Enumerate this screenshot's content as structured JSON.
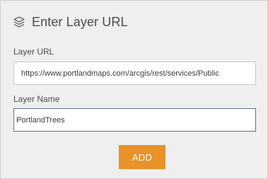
{
  "header": {
    "icon": "layers-icon",
    "title": "Enter Layer URL"
  },
  "form": {
    "url_label": "Layer URL",
    "url_value": "https://www.portlandmaps.com/arcgis/rest/services/Public",
    "name_label": "Layer Name",
    "name_value": "PortlandTrees",
    "add_label": "ADD"
  },
  "colors": {
    "panel_background": "#efefef",
    "accent_button": "#e8922a",
    "focused_border": "#5c6f8f"
  }
}
